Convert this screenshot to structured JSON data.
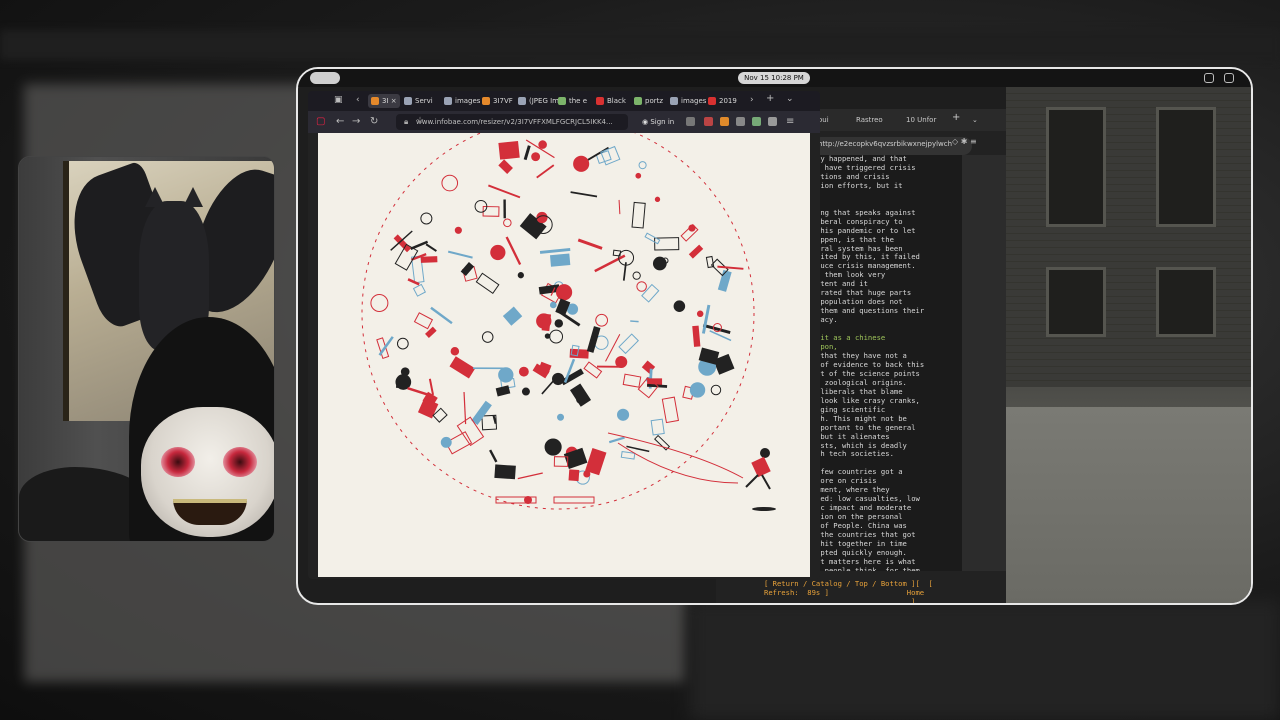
{
  "browser": {
    "tabs": [
      {
        "label": "3I",
        "color": "#e5892b",
        "active": true
      },
      {
        "label": "Servi",
        "color": "#9aa3b5",
        "active": false
      },
      {
        "label": "images i",
        "color": "#9aa3b5",
        "active": false
      },
      {
        "label": "3I7VF",
        "color": "#e5892b",
        "active": false
      },
      {
        "label": "(JPEG Im",
        "color": "#9aa3b5",
        "active": false
      },
      {
        "label": "the e",
        "color": "#7cb46a",
        "active": false
      },
      {
        "label": "Black",
        "color": "#d93131",
        "active": false
      },
      {
        "label": "portz",
        "color": "#7cb46a",
        "active": false
      },
      {
        "label": "images (",
        "color": "#9aa3b5",
        "active": false
      },
      {
        "label": "2019",
        "color": "#d93131",
        "active": false
      }
    ],
    "url": "www.infobae.com/resizer/v2/3I7VFFXMLFGCRJCL5IKK4...",
    "signin_label": "Sign in"
  },
  "topbar": {
    "clock": "Nov 15  10:28 PM"
  },
  "terminal": {
    "tabs": [
      "Rastreo",
      "10 Unfor"
    ],
    "tab_prefix": "oui",
    "url": "http://e2ecopkv6qvzsrbikwxnejpylwch",
    "lines": [
      {
        "text": "ly happened, and that",
        "green": false
      },
      {
        "text": "t have triggered crisis",
        "green": false
      },
      {
        "text": "ations and crisis",
        "green": false
      },
      {
        "text": "tion efforts, but it",
        "green": false
      },
      {
        "text": "",
        "green": false
      },
      {
        "text": "",
        "green": false
      },
      {
        "text": "ing that speaks against",
        "green": false
      },
      {
        "text": "iberal conspiracy to",
        "green": false
      },
      {
        "text": "this pandemic or to let",
        "green": false
      },
      {
        "text": "appen, is that the",
        "green": false
      },
      {
        "text": "eral system has been",
        "green": false
      },
      {
        "text": "dited by this, it failed",
        "green": false
      },
      {
        "text": "duce crisis management.",
        "green": false
      },
      {
        "text": "e them look very",
        "green": false
      },
      {
        "text": "etent and it",
        "green": false
      },
      {
        "text": "trated that huge parts",
        "green": false
      },
      {
        "text": " population does not",
        "green": false
      },
      {
        "text": " them and questions their",
        "green": false
      },
      {
        "text": "macy.",
        "green": false
      },
      {
        "text": "",
        "green": false
      },
      {
        "text": " it as a chinese",
        "green": true
      },
      {
        "text": "apon,",
        "green": true
      },
      {
        "text": " that they have not a",
        "green": false
      },
      {
        "text": " of evidence to back this",
        "green": false
      },
      {
        "text": "st of the science points",
        "green": false
      },
      {
        "text": "s zoological origins.",
        "green": false
      },
      {
        "text": "oliberals that blame",
        "green": false
      },
      {
        "text": " look like crasy cranks,",
        "green": false
      },
      {
        "text": "aging scientific",
        "green": false
      },
      {
        "text": "ch. This might not be",
        "green": false
      },
      {
        "text": "mportant to the general",
        "green": false
      },
      {
        "text": " but it alienates",
        "green": false
      },
      {
        "text": "ists, which is deadly",
        "green": false
      },
      {
        "text": "gh tech societies.",
        "green": false
      },
      {
        "text": "",
        "green": false
      },
      {
        "text": " few countries got a",
        "green": false
      },
      {
        "text": "core on crisis",
        "green": false
      },
      {
        "text": "ement, where they",
        "green": false
      },
      {
        "text": "ved: low casualties, low",
        "green": false
      },
      {
        "text": "ic impact and moderate",
        "green": false
      },
      {
        "text": "tion on the personal",
        "green": false
      },
      {
        "text": " of People. China was",
        "green": false
      },
      {
        "text": " the countries that got",
        "green": false
      },
      {
        "text": "shit together in time",
        "green": false
      },
      {
        "text": "apted quickly enough.",
        "green": false
      },
      {
        "text": "at matters here is what",
        "green": false
      },
      {
        "text": "e people think, for them",
        "green": false
      }
    ],
    "footer_line1": "[ Return / Catalog / Top / Bottom ][  [",
    "footer_line2": "Refresh:  89s ]                  Home",
    "footer_line3": "                                  ]"
  },
  "colors": {
    "accent_red": "#d32f3a",
    "illustration_blue": "#6fa8c9",
    "terminal_orange": "#e8a23a",
    "terminal_green": "#9ec45a"
  }
}
